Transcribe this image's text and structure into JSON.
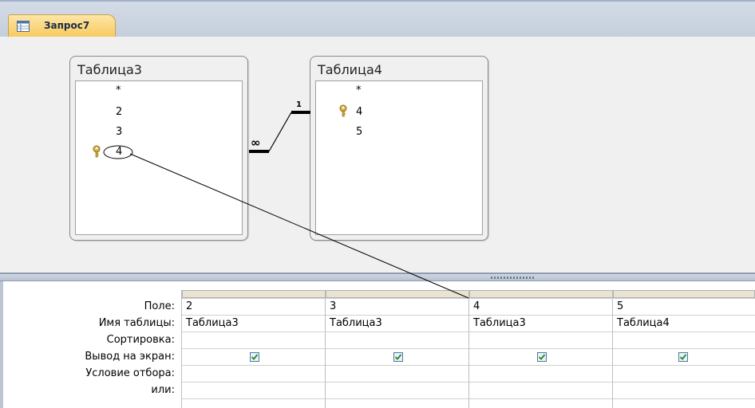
{
  "document_tab": {
    "label": "Запрос7",
    "icon": "query-icon"
  },
  "tables": [
    {
      "title": "Таблица3",
      "fields": [
        "*",
        "2",
        "3",
        "4"
      ],
      "key_field": "4"
    },
    {
      "title": "Таблица4",
      "fields": [
        "*",
        "4",
        "5"
      ],
      "key_field": "4"
    }
  ],
  "relationship": {
    "one_label": "1",
    "many_label": "∞"
  },
  "grid": {
    "row_labels": [
      "Поле:",
      "Имя таблицы:",
      "Сортировка:",
      "Вывод на экран:",
      "Условие отбора:",
      "или:"
    ],
    "columns": [
      {
        "field": "2",
        "table": "Таблица3",
        "sort": "",
        "show": true
      },
      {
        "field": "3",
        "table": "Таблица3",
        "sort": "",
        "show": true
      },
      {
        "field": "4",
        "table": "Таблица3",
        "sort": "",
        "show": true
      },
      {
        "field": "5",
        "table": "Таблица4",
        "sort": "",
        "show": true
      }
    ]
  },
  "colors": {
    "tab_active": "#f7c85a",
    "grid_line": "#d0d0d0",
    "panel_bg": "#f0f0f0"
  }
}
